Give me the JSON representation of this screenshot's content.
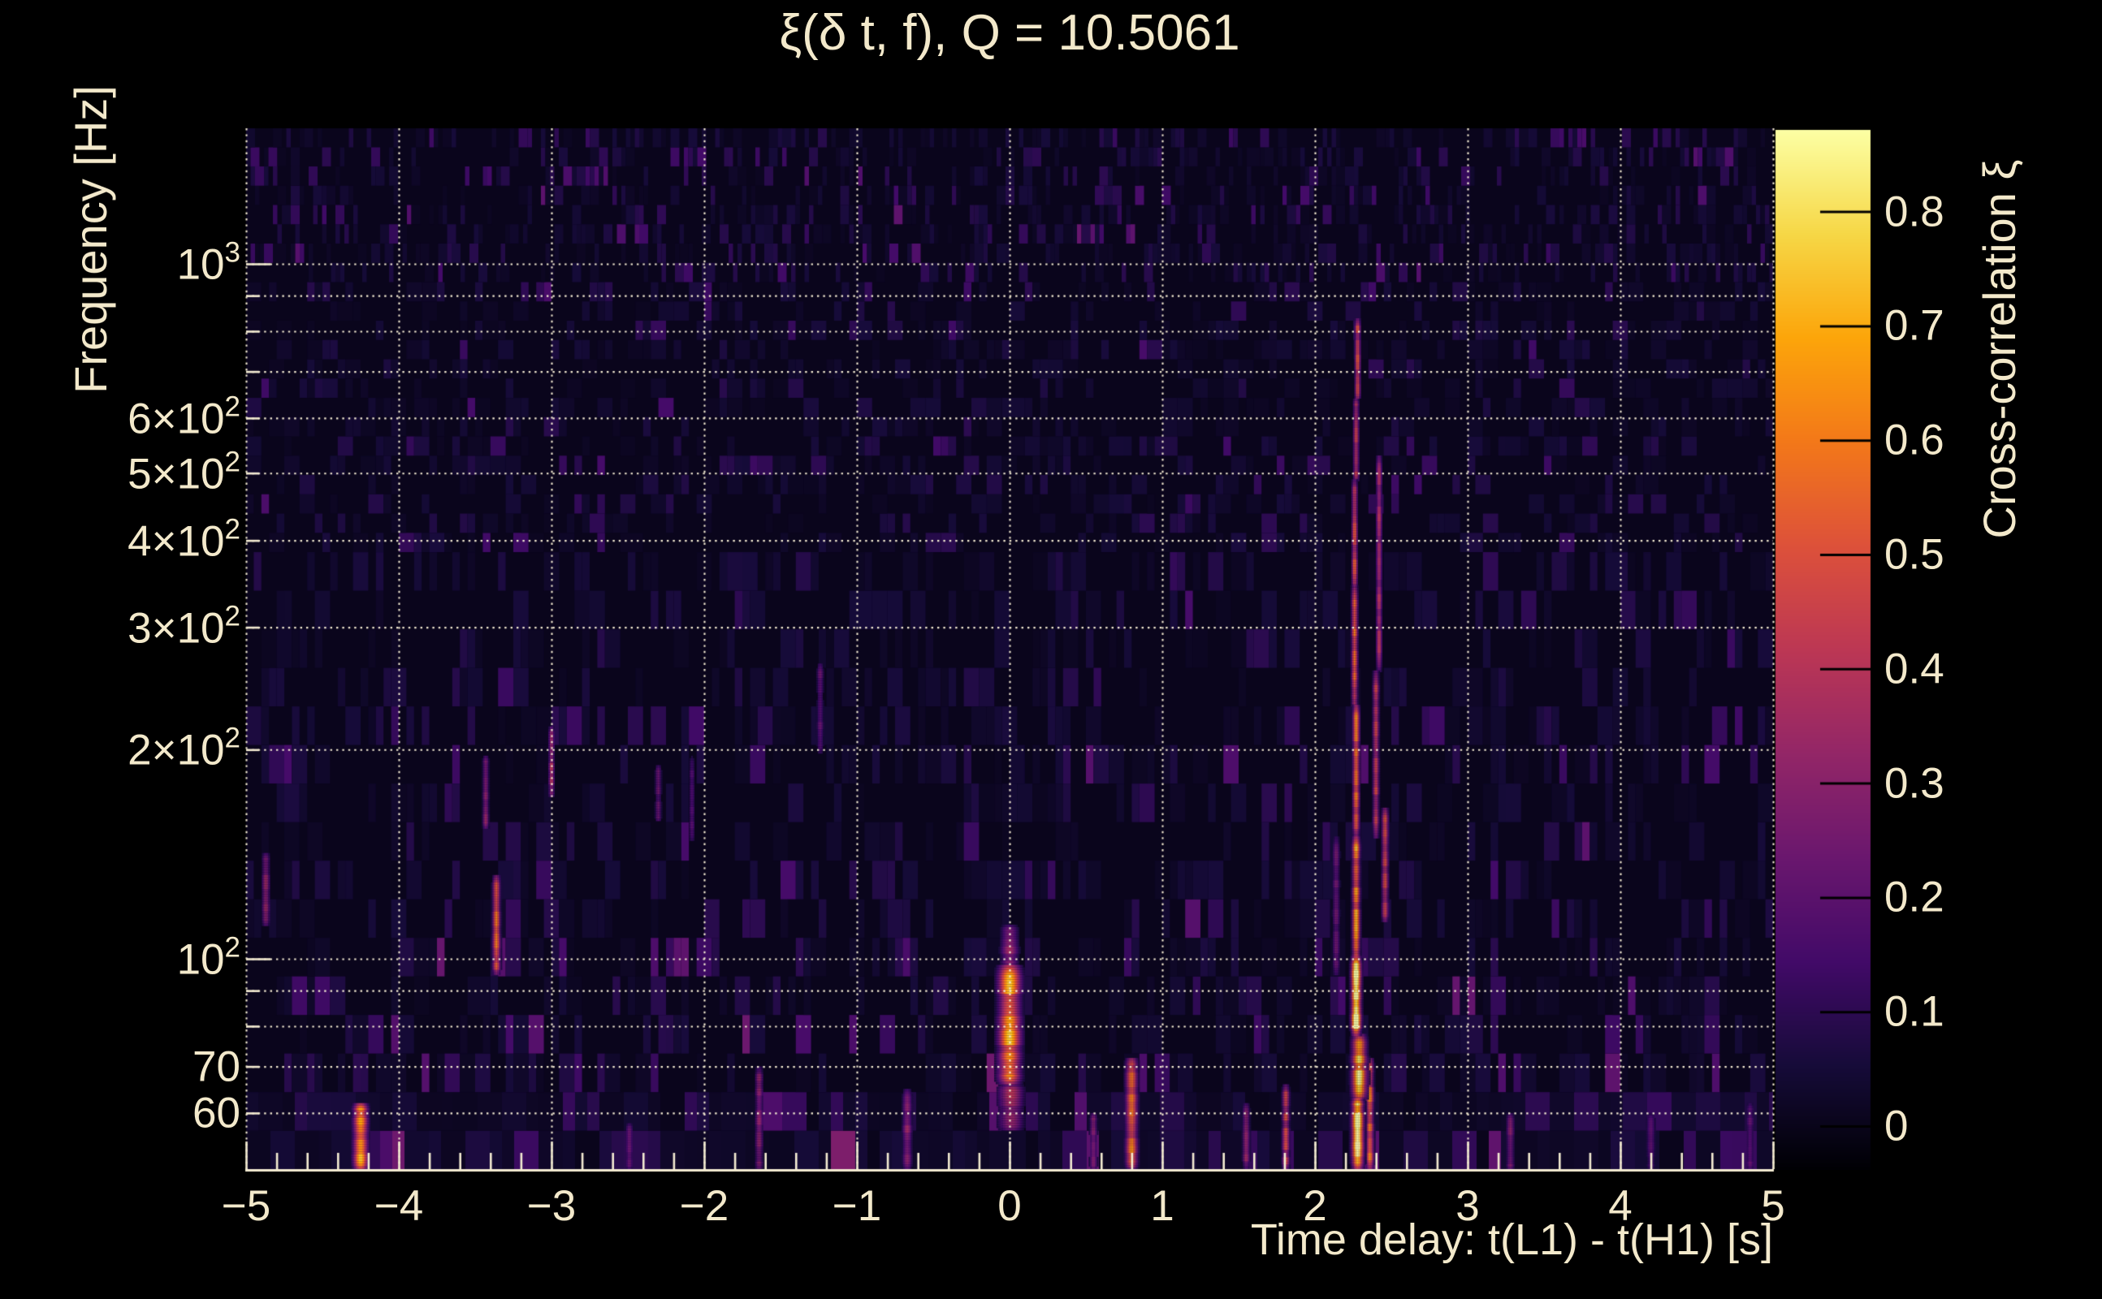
{
  "title": "ξ(δ t, f), Q = 10.5061",
  "q_value": 10.5061,
  "colors": {
    "background": "#000000",
    "text": "#f3e9cb",
    "grid": "#f4ecd2",
    "axis": "#f4ecd2",
    "colorbar_tick": "#000000"
  },
  "colormap": {
    "name": "inferno",
    "anchors": [
      "#000004",
      "#160b39",
      "#420a68",
      "#6a176e",
      "#932667",
      "#bc3754",
      "#dd513a",
      "#f37819",
      "#fca50a",
      "#f6d746",
      "#fcffa4"
    ]
  },
  "chart_data": {
    "type": "heatmap",
    "title": "ξ(δ t, f), Q = 10.5061",
    "xlabel": "Time delay: t(L1) - t(H1) [s]",
    "ylabel": "Frequency [Hz]",
    "colorbar_label": "Cross-correlation ξ",
    "x_axis": {
      "scale": "linear",
      "min": -5,
      "max": 5,
      "minor_tick_step": 0.2,
      "gridlines": [
        -5,
        -4,
        -3,
        -2,
        -1,
        0,
        1,
        2,
        3,
        4,
        5
      ],
      "ticks": [
        {
          "v": -5,
          "label": "−5"
        },
        {
          "v": -4,
          "label": "−4"
        },
        {
          "v": -3,
          "label": "−3"
        },
        {
          "v": -2,
          "label": "−2"
        },
        {
          "v": -1,
          "label": "−1"
        },
        {
          "v": 0,
          "label": "0"
        },
        {
          "v": 1,
          "label": "1"
        },
        {
          "v": 2,
          "label": "2"
        },
        {
          "v": 3,
          "label": "3"
        },
        {
          "v": 4,
          "label": "4"
        },
        {
          "v": 5,
          "label": "5"
        }
      ]
    },
    "y_axis": {
      "scale": "log",
      "min": 49.8,
      "max": 1567,
      "gridlines": [
        60,
        70,
        80,
        90,
        100,
        200,
        300,
        400,
        500,
        600,
        700,
        800,
        900,
        1000
      ],
      "major_values": [
        100,
        1000
      ],
      "ticks": [
        {
          "v": 1000,
          "m": "10",
          "e": "3"
        },
        {
          "v": 600,
          "m": "6×10",
          "e": "2"
        },
        {
          "v": 500,
          "m": "5×10",
          "e": "2"
        },
        {
          "v": 400,
          "m": "4×10",
          "e": "2"
        },
        {
          "v": 300,
          "m": "3×10",
          "e": "2"
        },
        {
          "v": 200,
          "m": "2×10",
          "e": "2"
        },
        {
          "v": 100,
          "m": "10",
          "e": "2"
        },
        {
          "v": 70,
          "m": "70",
          "e": ""
        },
        {
          "v": 60,
          "m": "60",
          "e": ""
        }
      ]
    },
    "colorbar": {
      "min": -0.0376,
      "max": 0.8714,
      "ticks": [
        {
          "v": 0.8,
          "label": "0.8"
        },
        {
          "v": 0.7,
          "label": "0.7"
        },
        {
          "v": 0.6,
          "label": "0.6"
        },
        {
          "v": 0.5,
          "label": "0.5"
        },
        {
          "v": 0.4,
          "label": "0.4"
        },
        {
          "v": 0.3,
          "label": "0.3"
        },
        {
          "v": 0.2,
          "label": "0.2"
        },
        {
          "v": 0.1,
          "label": "0.1"
        },
        {
          "v": 0,
          "label": "0"
        }
      ]
    },
    "noise": {
      "seed": 20817,
      "base_floor": 0.004
    },
    "features": [
      {
        "t": 2.28,
        "dt": 0.024,
        "f": [
          50,
          63
        ],
        "xi": 0.78
      },
      {
        "t": 2.29,
        "dt": 0.03,
        "f": [
          63,
          78
        ],
        "xi": 0.7
      },
      {
        "t": 2.27,
        "dt": 0.02,
        "f": [
          78,
          101
        ],
        "xi": 0.86
      },
      {
        "t": 2.27,
        "dt": 0.016,
        "f": [
          101,
          150
        ],
        "xi": 0.6
      },
      {
        "t": 2.27,
        "dt": 0.014,
        "f": [
          150,
          232
        ],
        "xi": 0.54
      },
      {
        "t": 2.26,
        "dt": 0.013,
        "f": [
          232,
          345
        ],
        "xi": 0.5
      },
      {
        "t": 2.26,
        "dt": 0.012,
        "f": [
          345,
          490
        ],
        "xi": 0.46
      },
      {
        "t": 2.27,
        "dt": 0.011,
        "f": [
          490,
          640
        ],
        "xi": 0.4
      },
      {
        "t": 2.28,
        "dt": 0.01,
        "f": [
          640,
          835
        ],
        "xi": 0.44
      },
      {
        "t": 2.36,
        "dt": 0.016,
        "f": [
          50,
          72
        ],
        "xi": 0.52
      },
      {
        "t": 2.4,
        "dt": 0.013,
        "f": [
          150,
          260
        ],
        "xi": 0.4
      },
      {
        "t": 2.42,
        "dt": 0.012,
        "f": [
          260,
          530
        ],
        "xi": 0.36
      },
      {
        "t": 2.46,
        "dt": 0.014,
        "f": [
          113,
          165
        ],
        "xi": 0.42
      },
      {
        "t": 2.14,
        "dt": 0.015,
        "f": [
          95,
          150
        ],
        "xi": 0.22
      },
      {
        "t": 0.0,
        "dt": 0.046,
        "f": [
          66,
          98
        ],
        "xi": 0.62
      },
      {
        "t": 0.0,
        "dt": 0.036,
        "f": [
          98,
          112
        ],
        "xi": 0.3
      },
      {
        "t": 0.01,
        "dt": 0.05,
        "f": [
          57,
          66
        ],
        "xi": 0.34
      },
      {
        "t": -4.25,
        "dt": 0.03,
        "f": [
          50,
          62
        ],
        "xi": 0.6
      },
      {
        "t": -4.87,
        "dt": 0.016,
        "f": [
          112,
          142
        ],
        "xi": 0.28
      },
      {
        "t": -3.36,
        "dt": 0.016,
        "f": [
          95,
          132
        ],
        "xi": 0.5
      },
      {
        "t": -3.43,
        "dt": 0.013,
        "f": [
          155,
          196
        ],
        "xi": 0.3
      },
      {
        "t": -3.0,
        "dt": 0.012,
        "f": [
          172,
          216
        ],
        "xi": 0.34
      },
      {
        "t": -2.49,
        "dt": 0.015,
        "f": [
          50,
          58
        ],
        "xi": 0.2
      },
      {
        "t": -2.3,
        "dt": 0.013,
        "f": [
          158,
          190
        ],
        "xi": 0.21
      },
      {
        "t": -2.08,
        "dt": 0.013,
        "f": [
          148,
          196
        ],
        "xi": 0.16
      },
      {
        "t": -1.64,
        "dt": 0.016,
        "f": [
          50,
          70
        ],
        "xi": 0.28
      },
      {
        "t": -1.24,
        "dt": 0.014,
        "f": [
          198,
          266
        ],
        "xi": 0.2
      },
      {
        "t": -0.67,
        "dt": 0.02,
        "f": [
          50,
          65
        ],
        "xi": 0.28
      },
      {
        "t": 0.55,
        "dt": 0.015,
        "f": [
          50,
          60
        ],
        "xi": 0.26
      },
      {
        "t": 0.8,
        "dt": 0.025,
        "f": [
          50,
          72
        ],
        "xi": 0.55
      },
      {
        "t": 1.55,
        "dt": 0.015,
        "f": [
          50,
          62
        ],
        "xi": 0.3
      },
      {
        "t": 1.81,
        "dt": 0.015,
        "f": [
          50,
          66
        ],
        "xi": 0.42
      },
      {
        "t": 3.28,
        "dt": 0.016,
        "f": [
          50,
          60
        ],
        "xi": 0.28
      },
      {
        "t": 4.2,
        "dt": 0.018,
        "f": [
          50,
          60
        ],
        "xi": 0.17
      },
      {
        "t": 4.85,
        "dt": 0.015,
        "f": [
          50,
          62
        ],
        "xi": 0.2
      }
    ]
  }
}
